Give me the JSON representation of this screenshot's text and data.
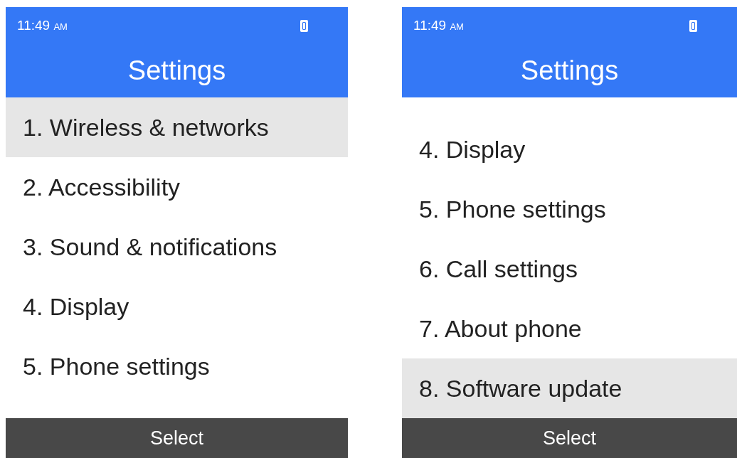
{
  "screens": [
    {
      "status_bar": {
        "time": "11:49",
        "meridiem": "AM"
      },
      "title": "Settings",
      "items": [
        {
          "label": "1. Wireless & networks",
          "selected": true
        },
        {
          "label": "2. Accessibility",
          "selected": false
        },
        {
          "label": "3. Sound & notifications",
          "selected": false
        },
        {
          "label": "4. Display",
          "selected": false
        },
        {
          "label": "5. Phone settings",
          "selected": false
        }
      ],
      "scrolled_to_end": false,
      "softkey": "Select"
    },
    {
      "status_bar": {
        "time": "11:49",
        "meridiem": "AM"
      },
      "title": "Settings",
      "items": [
        {
          "label": "4. Display",
          "selected": false
        },
        {
          "label": "5. Phone settings",
          "selected": false
        },
        {
          "label": "6. Call settings",
          "selected": false
        },
        {
          "label": "7. About phone",
          "selected": false
        },
        {
          "label": "8. Software update",
          "selected": true
        }
      ],
      "scrolled_to_end": true,
      "softkey": "Select"
    }
  ]
}
